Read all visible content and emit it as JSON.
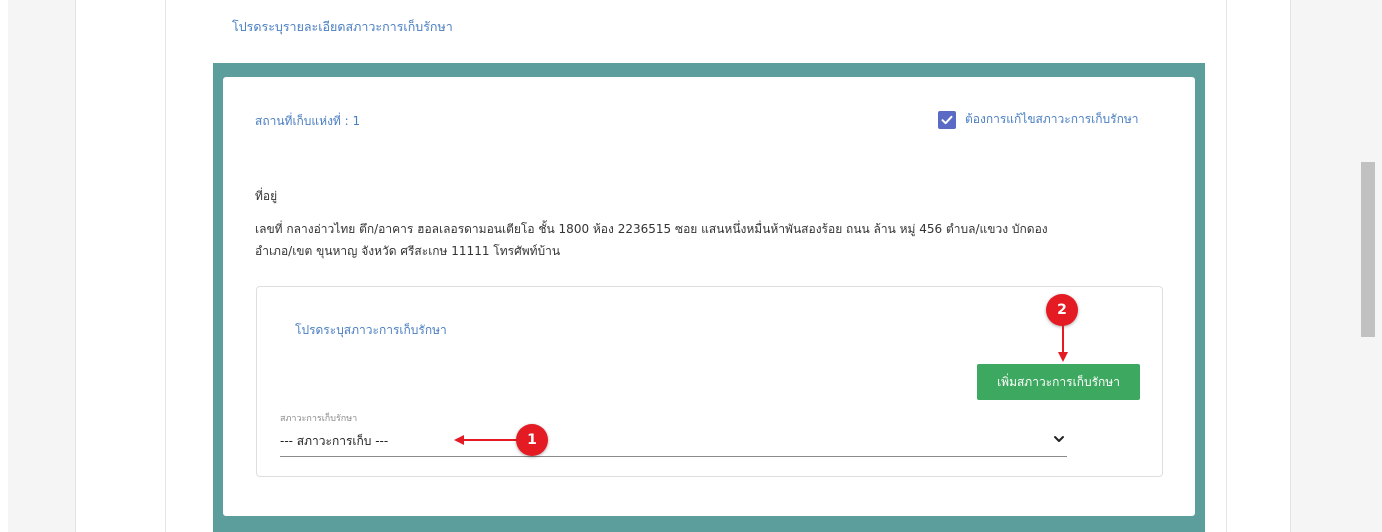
{
  "section": {
    "title": "โปรดระบุรายละเอียดสภาวะการเก็บรักษา"
  },
  "location": {
    "label": "สถานที่เก็บแห่งที่ : 1",
    "edit_checkbox_label": "ต้องการแก้ไขสภาวะการเก็บรักษา",
    "edit_checked": true
  },
  "address": {
    "heading": "ที่อยู่",
    "line1": "เลขที่ กลางอ่าวไทย ตึก/อาคาร ฮอลเลอรดามอนเตียโอ ชั้น 1800 ห้อง 2236515 ซอย แสนหนึ่งหมื่นห้าพันสองร้อย ถนน ล้าน หมู่ 456 ตำบล/แขวง บักดอง",
    "line2": "อำเภอ/เขต ขุนหาญ จังหวัด ศรีสะเกษ 11111 โทรศัพท์บ้าน"
  },
  "conditions": {
    "title": "โปรดระบุสภาวะการเก็บรักษา",
    "add_button_label": "เพิ่มสภาวะการเก็บรักษา",
    "select_label": "สภาวะการเก็บรักษา",
    "select_value": "--- สภาวะการเก็บ ---"
  },
  "callouts": {
    "one": "1",
    "two": "2"
  },
  "colors": {
    "accent_blue": "#4a7ec2",
    "teal_frame": "#5c9e9c",
    "button_green": "#3da85f",
    "callout_red": "#e41b23",
    "checkbox": "#5b6ac4"
  }
}
